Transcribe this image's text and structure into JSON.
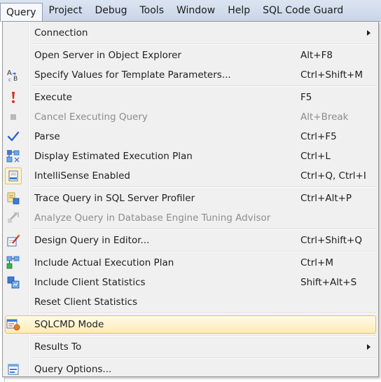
{
  "menubar": {
    "items": [
      "Query",
      "Project",
      "Debug",
      "Tools",
      "Window",
      "Help",
      "SQL Code Guard"
    ]
  },
  "menu": {
    "connection": {
      "label": "Connection"
    },
    "open_server": {
      "label": "Open Server in Object Explorer",
      "shortcut": "Alt+F8"
    },
    "specify_values": {
      "label": "Specify Values for Template Parameters...",
      "shortcut": "Ctrl+Shift+M"
    },
    "execute": {
      "label": "Execute",
      "shortcut": "F5"
    },
    "cancel_executing": {
      "label": "Cancel Executing Query",
      "shortcut": "Alt+Break"
    },
    "parse": {
      "label": "Parse",
      "shortcut": "Ctrl+F5"
    },
    "display_plan": {
      "label": "Display Estimated Execution Plan",
      "shortcut": "Ctrl+L"
    },
    "intellisense": {
      "label": "IntelliSense Enabled",
      "shortcut": "Ctrl+Q, Ctrl+I"
    },
    "trace_query": {
      "label": "Trace Query in SQL Server Profiler",
      "shortcut": "Ctrl+Alt+P"
    },
    "analyze_query": {
      "label": "Analyze Query in Database Engine Tuning Advisor"
    },
    "design_query": {
      "label": "Design Query in Editor...",
      "shortcut": "Ctrl+Shift+Q"
    },
    "include_plan": {
      "label": "Include Actual Execution Plan",
      "shortcut": "Ctrl+M"
    },
    "include_stats": {
      "label": "Include Client Statistics",
      "shortcut": "Shift+Alt+S"
    },
    "reset_stats": {
      "label": "Reset Client Statistics"
    },
    "sqlcmd": {
      "label": "SQLCMD Mode"
    },
    "results_to": {
      "label": "Results To"
    },
    "query_options": {
      "label": "Query Options..."
    }
  },
  "colors": {
    "highlight_border": "#e5c365",
    "highlight_fill": "#fdeab7",
    "disabled_text": "#8d8d8d",
    "execute_icon": "#d9302a"
  }
}
